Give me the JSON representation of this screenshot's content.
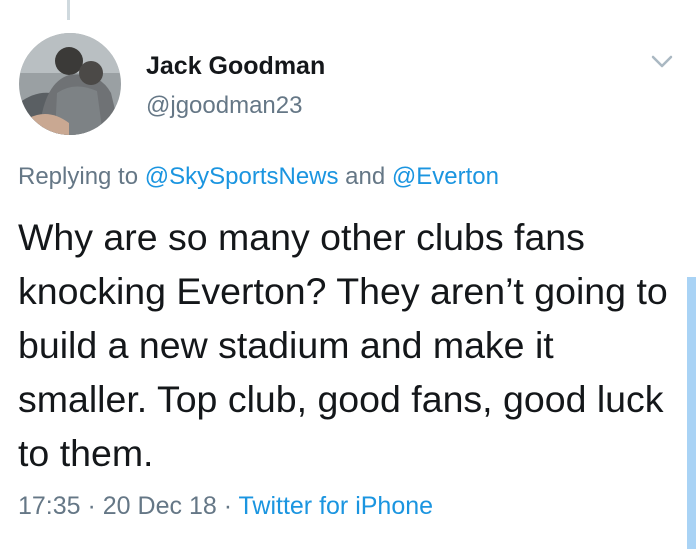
{
  "tweet": {
    "author": {
      "display_name": "Jack Goodman",
      "handle": "@jgoodman23"
    },
    "reply": {
      "prefix": "Replying to ",
      "mentions": [
        "@SkySportsNews",
        "@Everton"
      ],
      "conjunction": " and "
    },
    "text": "Why are so many other clubs fans knocking Everton? They aren’t going to build a new stadium and make it smaller. Top club, good fans, good luck to them.",
    "meta": {
      "time": "17:35",
      "separator": " · ",
      "date": "20 Dec 18",
      "source": "Twitter for iPhone"
    }
  },
  "icons": {
    "caret": "chevron-down-icon"
  },
  "colors": {
    "text_primary": "#14171a",
    "text_secondary": "#657786",
    "link": "#1b95e0",
    "caret": "#aab8c2",
    "thread_line": "#cfd9de"
  }
}
